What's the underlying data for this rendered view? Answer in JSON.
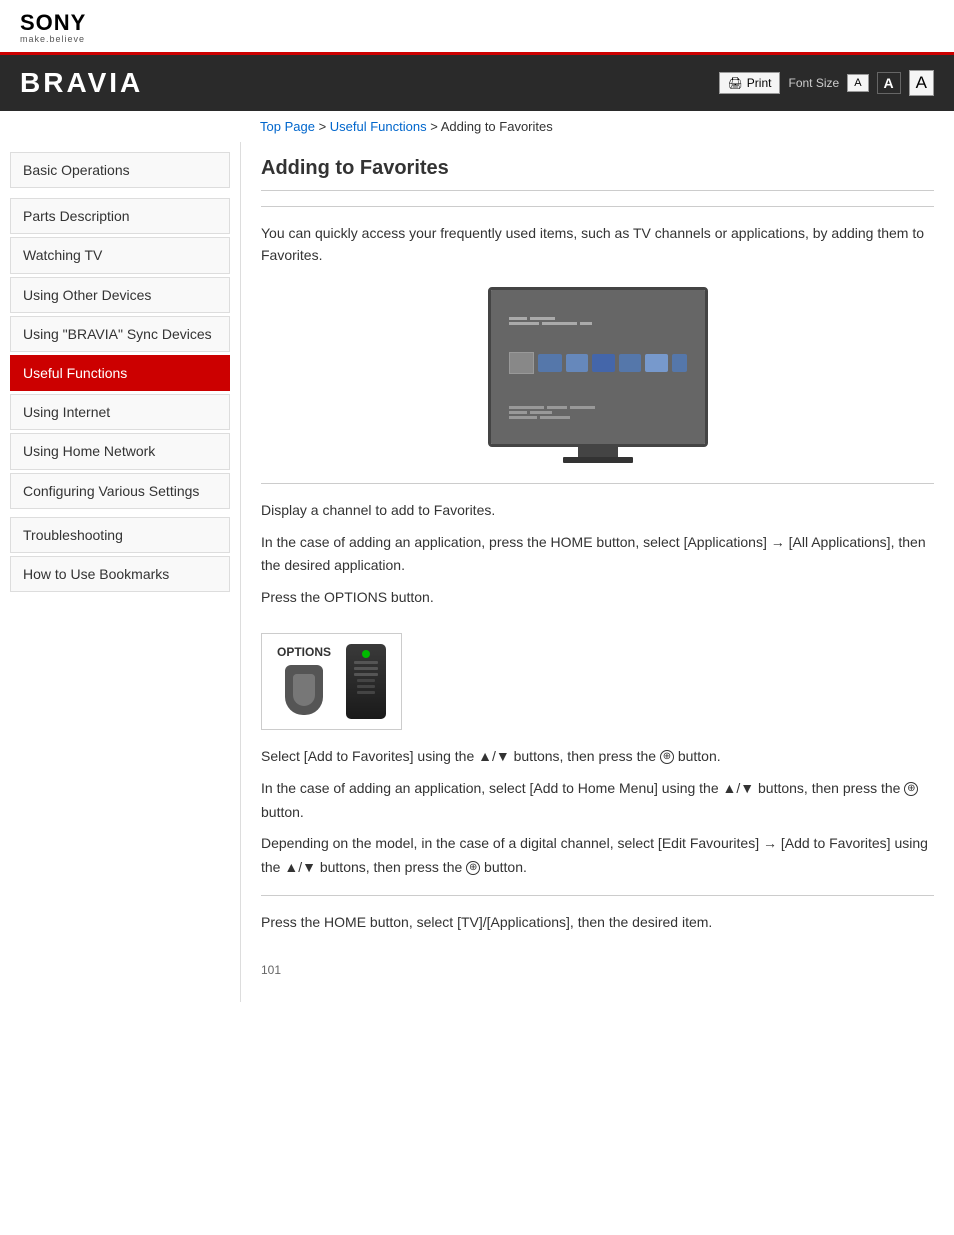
{
  "header": {
    "sony_logo": "SONY",
    "sony_tagline": "make.believe",
    "bravia_title": "BRAVIA",
    "print_button": "Print",
    "font_size_label": "Font Size",
    "font_small": "A",
    "font_medium": "A",
    "font_large": "A"
  },
  "breadcrumb": {
    "top_page": "Top Page",
    "separator1": " > ",
    "useful_functions": "Useful Functions",
    "separator2": " >  ",
    "current": "Adding to Favorites"
  },
  "sidebar": {
    "items": [
      {
        "id": "basic-operations",
        "label": "Basic Operations",
        "active": false
      },
      {
        "id": "parts-description",
        "label": "Parts Description",
        "active": false
      },
      {
        "id": "watching-tv",
        "label": "Watching TV",
        "active": false
      },
      {
        "id": "using-other-devices",
        "label": "Using Other Devices",
        "active": false
      },
      {
        "id": "using-bravia-sync",
        "label": "Using \"BRAVIA\" Sync Devices",
        "active": false
      },
      {
        "id": "useful-functions",
        "label": "Useful Functions",
        "active": true
      },
      {
        "id": "using-internet",
        "label": "Using Internet",
        "active": false
      },
      {
        "id": "using-home-network",
        "label": "Using Home Network",
        "active": false
      },
      {
        "id": "configuring-settings",
        "label": "Configuring Various Settings",
        "active": false
      }
    ],
    "items2": [
      {
        "id": "troubleshooting",
        "label": "Troubleshooting",
        "active": false
      },
      {
        "id": "how-to-use",
        "label": "How to Use Bookmarks",
        "active": false
      }
    ]
  },
  "content": {
    "title": "Adding to Favorites",
    "intro": "You can quickly access your frequently used items, such as TV channels or applications, by adding them to Favorites.",
    "step1": "Display a channel to add to Favorites.",
    "step2": "In the case of adding an application, press the HOME button, select [Applications] → [All Applications], then the desired application.",
    "step3": "Press the OPTIONS button.",
    "step4": "Select [Add to Favorites] using the ▲/▼ buttons, then press the ⊕ button.",
    "step5": "In the case of adding an application, select [Add to Home Menu] using the ▲/▼ buttons, then press the ⊕ button.",
    "step6": "Depending on the model, in the case of a digital channel, select [Edit Favourites] → [Add to Favorites] using the ▲/▼ buttons, then press the ⊕ button.",
    "step7": "Press the HOME button, select [TV]/[Applications], then the desired item.",
    "options_label": "OPTIONS",
    "page_number": "101"
  }
}
